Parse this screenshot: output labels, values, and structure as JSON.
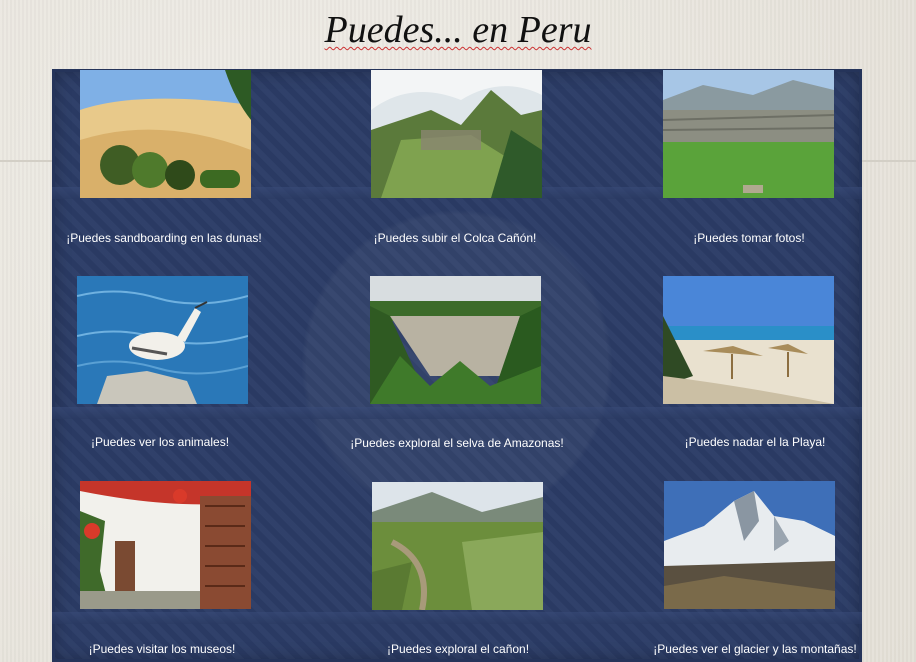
{
  "title": "Puedes... en Peru",
  "colors": {
    "board": "#2b3c66",
    "caption": "#ffffff",
    "spell": "#d44444"
  },
  "tiles": [
    {
      "caption": "¡Puedes sandboarding en las dunas!",
      "icon": "sand-dunes-photo"
    },
    {
      "caption": "¡Puedes subir el Colca Cañón!",
      "icon": "machu-picchu-photo"
    },
    {
      "caption": "¡Puedes tomar fotos!",
      "icon": "inca-ruins-photo"
    },
    {
      "caption": "¡Puedes ver los animales!",
      "icon": "booby-bird-photo"
    },
    {
      "caption": "¡Puedes exploral el selva de Amazonas!",
      "icon": "amazon-river-photo"
    },
    {
      "caption": "¡Puedes nadar el la Playa!",
      "icon": "beach-photo"
    },
    {
      "caption": "¡Puedes visitar los museos!",
      "icon": "museum-photo"
    },
    {
      "caption": "¡Puedes exploral el cañon!",
      "icon": "canyon-photo"
    },
    {
      "caption": "¡Puedes ver el glacier y las montañas!",
      "icon": "glacier-photo"
    }
  ]
}
